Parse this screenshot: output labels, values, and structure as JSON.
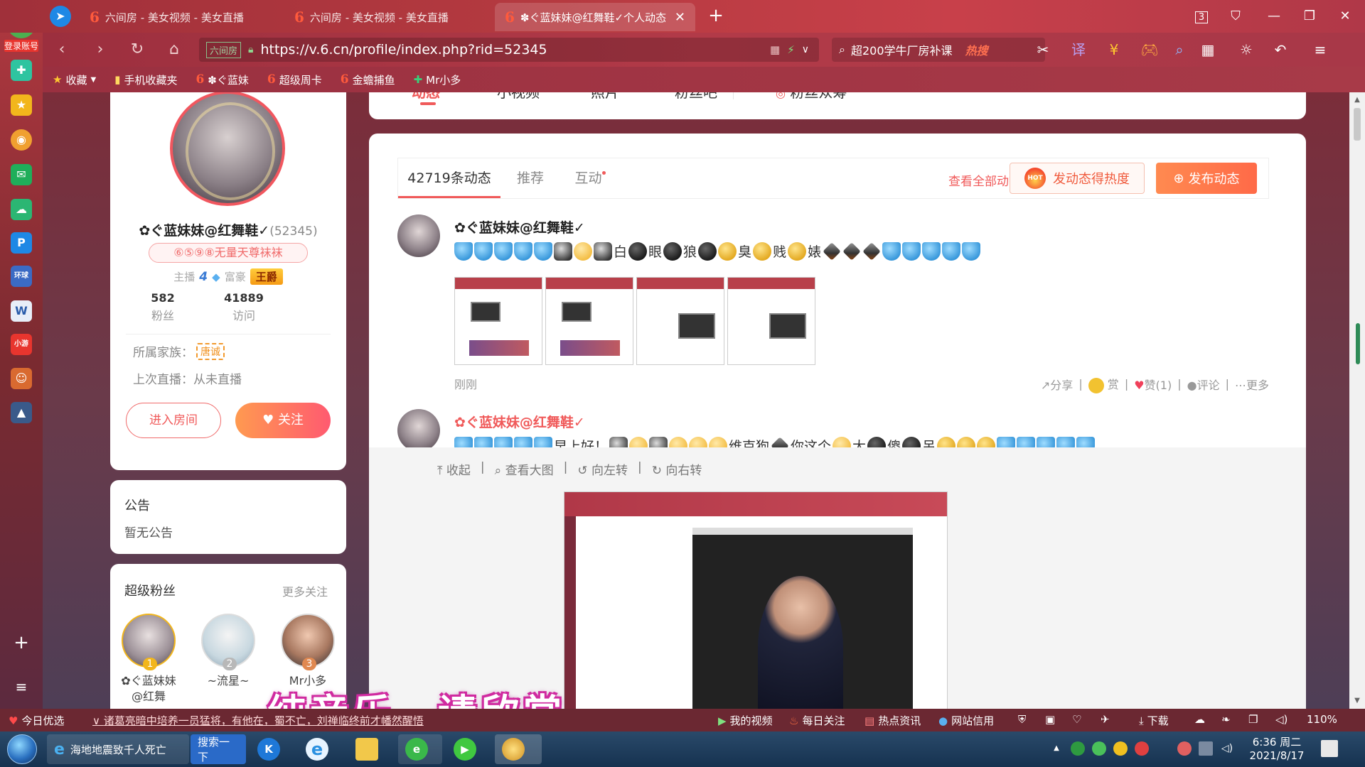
{
  "browser": {
    "tabs": [
      {
        "label": "六间房 - 美女视频 - 美女直播",
        "active": false
      },
      {
        "label": "六间房 - 美女视频 - 美女直播",
        "active": false
      },
      {
        "label": "✽ぐ蓝妹妹@红舞鞋✓个人动态",
        "active": true
      }
    ],
    "tab_count": "3",
    "address": "https://v.6.cn/profile/index.php?rid=52345",
    "address_badge": "六间房",
    "search_text": "超200学牛厂房补课",
    "search_hot": "热搜",
    "zoom": "110%"
  },
  "bookmarks": [
    "收藏",
    "手机收藏夹",
    "✽ぐ蓝妹",
    "超级周卡",
    "金蟾捕鱼",
    "Mr小多"
  ],
  "sidebar": {
    "login_label": "登录账号"
  },
  "profile": {
    "name": "✿ぐ蓝妹妹@红舞鞋✓",
    "rid": "(52345)",
    "title_badge": "⑥⑤⑨⑧无量天尊袜袜",
    "anchor_label": "主播",
    "anchor_level": "4",
    "rich_label": "富豪",
    "rich_rank": "王爵",
    "fans_count": "582",
    "fans_label": "粉丝",
    "visits_count": "41889",
    "visits_label": "访问",
    "family_label": "所属家族：",
    "family_tag": "唐诚",
    "last_live": "上次直播：从未直播",
    "enter_room": "进入房间",
    "follow": "关注"
  },
  "notice": {
    "title": "公告",
    "body": "暂无公告"
  },
  "superfans": {
    "title": "超级粉丝",
    "more": "更多关注",
    "fans": [
      {
        "rank": "1",
        "name": "✿ぐ蓝妹妹@红舞",
        "color": "#f2b61c"
      },
      {
        "rank": "2",
        "name": "~流星~",
        "color": "#b8b8b8"
      },
      {
        "rank": "3",
        "name": "Mr小多",
        "color": "#e08850"
      }
    ]
  },
  "topnav": [
    "动态",
    "小视频",
    "照片",
    "粉丝吧",
    "粉丝众筹"
  ],
  "feed": {
    "tabs": [
      "42719条动态",
      "推荐",
      "互动"
    ],
    "view_all": "查看全部动态",
    "hot_button": "发动态得热度",
    "hot_icon": "HOT",
    "post_button": "发布动态",
    "posts": [
      {
        "name": "✿ぐ蓝妹妹@红舞鞋✓",
        "time": "刚刚",
        "share": "分享",
        "reward": "赏",
        "like": "赞(1)",
        "comment": "评论",
        "more": "更多"
      },
      {
        "name": "✿ぐ蓝妹妹@红舞鞋✓",
        "text": "早上好！"
      }
    ],
    "image_tools": [
      "收起",
      "查看大图",
      "向左转",
      "向右转"
    ]
  },
  "post1_words": [
    "白",
    "眼",
    "狼",
    "臭",
    "贱",
    "婊"
  ],
  "post2_words": [
    "维克狗",
    "你这个",
    "大",
    "傻",
    "吊"
  ],
  "caption": "纯音乐，请欣赏",
  "statusbar": {
    "today": "今日优选",
    "ticker": "诸葛亮暗中培养一员猛将，有他在，蜀不亡，刘禅临终前才幡然醒悟",
    "items": [
      "我的视频",
      "每日关注",
      "热点资讯",
      "网站信用",
      "下载"
    ]
  },
  "taskbar": {
    "items": [
      "海地地震致千人死亡",
      "搜索一下"
    ],
    "time": "6:36 周二",
    "date": "2021/8/17"
  }
}
